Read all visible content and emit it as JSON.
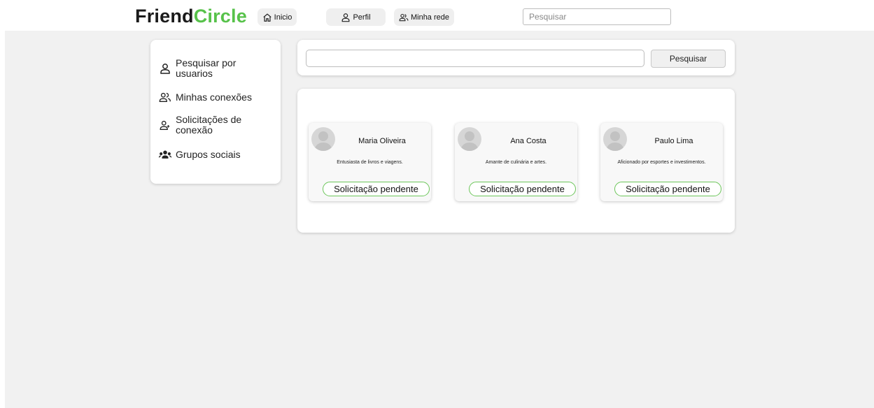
{
  "header": {
    "logo_part1": "Friend",
    "logo_part2": "Circle",
    "nav": {
      "home_label": "Inicio",
      "profile_label": "Perfil",
      "network_label": "Minha rede"
    },
    "search_placeholder": "Pesquisar"
  },
  "sidebar": {
    "items": [
      {
        "label": "Pesquisar por usuarios",
        "icon": "user-icon"
      },
      {
        "label": "Minhas conexões",
        "icon": "users-icon"
      },
      {
        "label": "Solicitações de conexão",
        "icon": "user-request-icon"
      },
      {
        "label": "Grupos sociais",
        "icon": "group-icon"
      }
    ]
  },
  "search": {
    "value": "",
    "button_label": "Pesquisar"
  },
  "results": [
    {
      "name": "Maria Oliveira",
      "bio": "Entusiasta de livros e viagens.",
      "action": "Solicitação pendente"
    },
    {
      "name": "Ana Costa",
      "bio": "Amante de culinária e artes.",
      "action": "Solicitação pendente"
    },
    {
      "name": "Paulo Lima",
      "bio": "Aficionado por esportes e investimentos.",
      "action": "Solicitação pendente"
    }
  ],
  "colors": {
    "brand_dark": "#1a1a1a",
    "brand_green": "#57c24a",
    "page_bg": "#f1f1f1",
    "pending_border": "#6cc65a"
  }
}
